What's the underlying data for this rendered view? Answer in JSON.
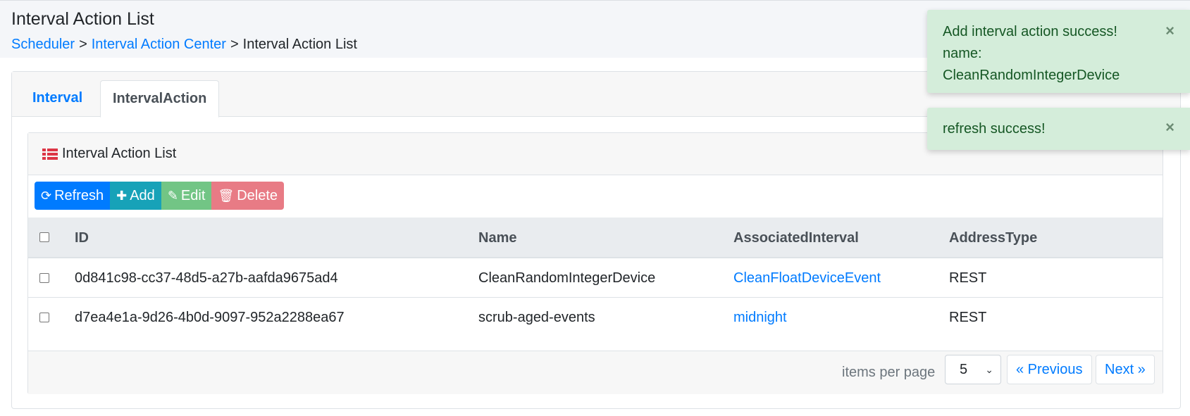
{
  "header": {
    "title": "Interval Action List",
    "breadcrumb": [
      {
        "label": "Scheduler",
        "link": true
      },
      {
        "label": "Interval Action Center",
        "link": true
      },
      {
        "label": "Interval Action List",
        "link": false
      }
    ],
    "separator": ">"
  },
  "tabs": [
    {
      "label": "Interval",
      "active": false
    },
    {
      "label": "IntervalAction",
      "active": true
    }
  ],
  "panel": {
    "title": "Interval Action List",
    "icon": "list-icon",
    "toolbar": {
      "refresh_label": "Refresh",
      "add_label": "Add",
      "edit_label": "Edit",
      "delete_label": "Delete"
    },
    "table": {
      "columns": [
        "ID",
        "Name",
        "AssociatedInterval",
        "AddressType"
      ],
      "rows": [
        {
          "id": "0d841c98-cc37-48d5-a27b-aafda9675ad4",
          "name": "CleanRandomIntegerDevice",
          "interval": "CleanFloatDeviceEvent",
          "address_type": "REST"
        },
        {
          "id": "d7ea4e1a-9d26-4b0d-9097-952a2288ea67",
          "name": "scrub-aged-events",
          "interval": "midnight",
          "address_type": "REST"
        }
      ]
    },
    "pagination": {
      "items_per_page_label": "items per page",
      "items_per_page_value": "5",
      "previous_label": "« Previous",
      "next_label": "Next »"
    }
  },
  "toasts": [
    {
      "lines": [
        "Add interval action success!",
        "name:",
        "CleanRandomIntegerDevice"
      ],
      "close": "×"
    },
    {
      "lines": [
        "refresh success!"
      ],
      "close": "×"
    }
  ],
  "colors": {
    "primary": "#007bff",
    "info": "#17a2b8",
    "success": "#28a745",
    "danger": "#dc3545",
    "toast_bg": "#d4edda",
    "toast_text": "#155724"
  }
}
